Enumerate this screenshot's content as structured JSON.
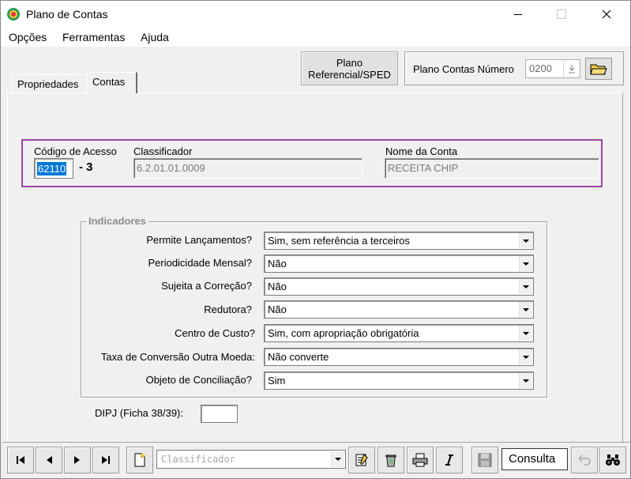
{
  "window": {
    "title": "Plano de Contas"
  },
  "menu": {
    "items": [
      {
        "label": "Opções"
      },
      {
        "label": "Ferramentas"
      },
      {
        "label": "Ajuda"
      }
    ]
  },
  "tabs": [
    {
      "label": "Propriedades",
      "active": false
    },
    {
      "label": "Contas",
      "active": true
    }
  ],
  "plano_referencial_button": {
    "line1": "Plano",
    "line2": "Referencial/SPED"
  },
  "plano_contas": {
    "label": "Plano Contas Número",
    "value": "0200"
  },
  "account": {
    "codigo_label": "Código de Acesso",
    "codigo_value": "62110",
    "digito": "- 3",
    "classificador_label": "Classificador",
    "classificador_value": "6.2.01.01.0009",
    "nome_label": "Nome da Conta",
    "nome_value": "RECEITA CHIP"
  },
  "indicadores": {
    "title": "Indicadores",
    "rows": [
      {
        "label": "Permite Lançamentos?",
        "value": "Sim, sem referência a terceiros"
      },
      {
        "label": "Periodicidade Mensal?",
        "value": "Não"
      },
      {
        "label": "Sujeita a Correção?",
        "value": "Não"
      },
      {
        "label": "Redutora?",
        "value": "Não"
      },
      {
        "label": "Centro de Custo?",
        "value": "Sim, com apropriação obrigatória"
      },
      {
        "label": "Taxa de Conversão Outra Moeda:",
        "value": "Não converte"
      },
      {
        "label": "Objeto de Conciliação?",
        "value": "Sim"
      }
    ]
  },
  "dipj": {
    "label": "DIPJ (Ficha 38/39):",
    "value": ""
  },
  "toolbar": {
    "search_placeholder": "Classificador",
    "mode": "Consulta",
    "icons": [
      "first-icon",
      "prev-icon",
      "next-icon",
      "last-icon",
      "new-icon",
      "edit-icon",
      "delete-icon",
      "print-icon",
      "italic-icon",
      "save-icon",
      "undo-icon",
      "binoculars-icon"
    ]
  },
  "colors": {
    "highlight_border": "#9b46a3",
    "selection": "#0078d7"
  }
}
